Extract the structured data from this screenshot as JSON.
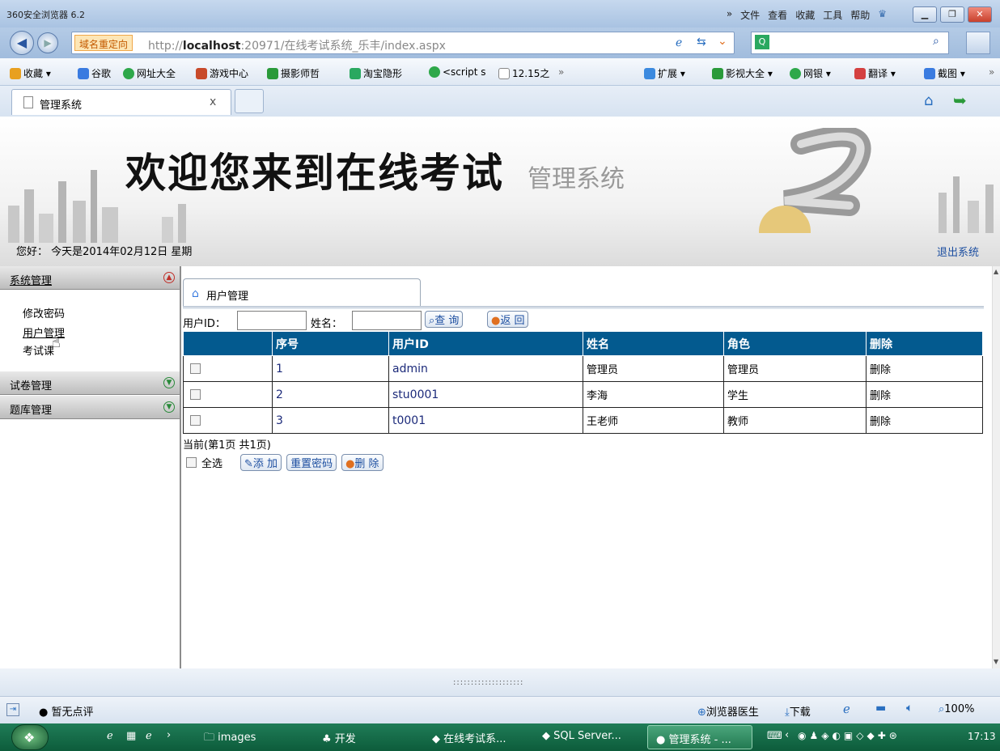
{
  "browser": {
    "window_title": "360安全浏览器 6.2",
    "menu": [
      "»",
      "文件",
      "查看",
      "收藏",
      "工具",
      "帮助"
    ],
    "address": {
      "redirect_badge": "域名重定向",
      "url_prefix": "http://",
      "url_host": "localhost",
      "url_rest": ":20971/在线考试系统_乐丰/index.aspx"
    },
    "bookmarks_left": [
      {
        "label": "收藏 ▾",
        "icon": "star-folder-icon",
        "color": "#e8a020"
      },
      {
        "label": "谷歌",
        "icon": "google-icon",
        "color": "#3a7be0"
      },
      {
        "label": "网址大全",
        "icon": "globe-icon",
        "color": "#2ea84a"
      },
      {
        "label": "游戏中心",
        "icon": "gamepad-icon",
        "color": "#c84a2a"
      },
      {
        "label": "摄影师哲",
        "icon": "douban-icon",
        "color": "#2a9a3a"
      },
      {
        "label": "淘宝隐形",
        "icon": "search-icon",
        "color": "#2aa860"
      },
      {
        "label": "<script s",
        "icon": "globe-icon",
        "color": "#2ea84a"
      },
      {
        "label": "12.15之",
        "icon": "page-icon",
        "color": "#ffffff"
      }
    ],
    "bookmarks_more": "»",
    "bookmarks_right": [
      {
        "label": "扩展 ▾",
        "icon": "extension-icon",
        "color": "#3c8adf"
      },
      {
        "label": "影视大全 ▾",
        "icon": "video-icon",
        "color": "#2a9a3a"
      },
      {
        "label": "网银 ▾",
        "icon": "bank-icon",
        "color": "#2ea84a"
      },
      {
        "label": "翻译 ▾",
        "icon": "translate-icon",
        "color": "#d44040"
      },
      {
        "label": "截图 ▾",
        "icon": "screenshot-icon",
        "color": "#3a7be0"
      }
    ],
    "bookmarks_right_more": "»",
    "tab": {
      "title": "管理系统",
      "close": "x"
    }
  },
  "page": {
    "banner_title": "欢迎您来到在线考试",
    "banner_subtitle": "管理系统",
    "greeting": "您好：  今天是2014年02月12日  星期",
    "logout": "退出系统"
  },
  "sidebar": {
    "sections": [
      {
        "label": "系统管理",
        "items": [
          "修改密码",
          "用户管理",
          "考试课"
        ]
      },
      {
        "label": "试卷管理",
        "items": []
      },
      {
        "label": "题库管理",
        "items": []
      }
    ]
  },
  "content": {
    "tab_label": "用户管理",
    "filter": {
      "user_id_label": "用户ID：",
      "name_label": "姓名：",
      "query_button": "查 询",
      "back_button": "返 回"
    },
    "table": {
      "columns": [
        "",
        "序号",
        "用户ID",
        "姓名",
        "角色",
        "删除"
      ],
      "rows": [
        {
          "seq": "1",
          "user_id": "admin",
          "name": "管理员",
          "role": "管理员",
          "delete": "删除"
        },
        {
          "seq": "2",
          "user_id": "stu0001",
          "name": "李海",
          "role": "学生",
          "delete": "删除"
        },
        {
          "seq": "3",
          "user_id": "t0001",
          "name": "王老师",
          "role": "教师",
          "delete": "删除"
        }
      ]
    },
    "pagination": "当前(第1页 共1页)",
    "select_all": "全选",
    "add_button": "添 加",
    "reset_password_button": "重置密码",
    "delete_button": "删 除"
  },
  "splitter_handle": "::::::::::::::::::::",
  "statusbar": {
    "rating": "暂无点评",
    "doctor": "浏览器医生",
    "download": "下载",
    "zoom": "100%"
  },
  "taskbar": {
    "items": [
      "images",
      "开发",
      "在线考试系...",
      "SQL Server...",
      "管理系统 - ..."
    ],
    "clock": "17:13"
  },
  "colors": {
    "table_header": "#035a8f",
    "link": "#1c4ea0",
    "taskbar": "#0d5c3b"
  }
}
